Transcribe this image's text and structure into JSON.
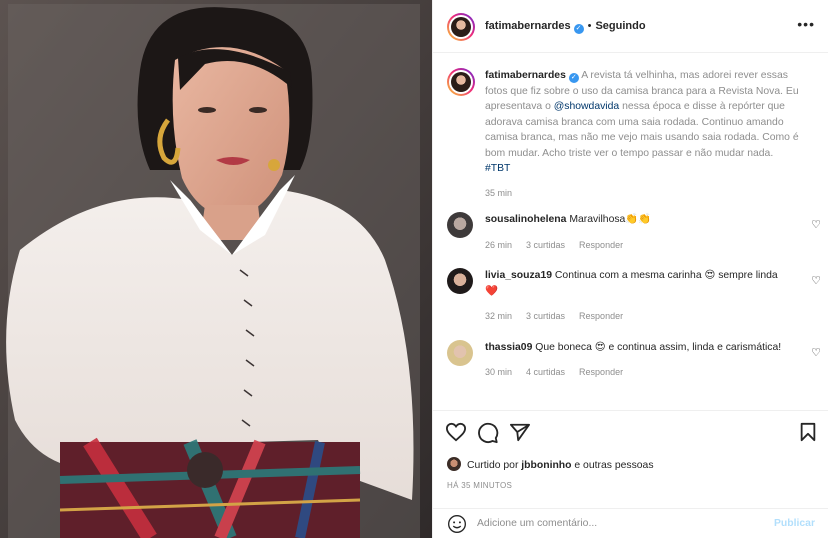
{
  "post": {
    "username": "fatimabernardes",
    "following_label": "Seguindo",
    "separator": "•",
    "more_icon": "more-icon"
  },
  "caption": {
    "username": "fatimabernardes",
    "text_1": "A revista tá velhinha, mas adorei rever essas fotos que fiz sobre o uso da camisa branca para a Revista Nova. Eu apresentava o ",
    "mention": "@showdavida",
    "text_2": " nessa época e disse à repórter que adorava camisa branca com uma saia rodada. Continuo amando camisa branca, mas não me vejo mais usando saia rodada. Como é bom mudar. Acho triste ver o tempo passar e não mudar nada.",
    "hashtag": "#TBT",
    "time": "35 min"
  },
  "comments": [
    {
      "user": "sousalinohelena",
      "text": "Maravilhosa👏👏",
      "time": "26 min",
      "likes": "3 curtidas",
      "reply": "Responder"
    },
    {
      "user": "livia_souza19",
      "text": "Continua com a mesma carinha 😍 sempre linda ❤️",
      "time": "32 min",
      "likes": "3 curtidas",
      "reply": "Responder"
    },
    {
      "user": "thassia09",
      "text": "Que boneca 😍 e continua assim, linda e carismática!",
      "time": "30 min",
      "likes": "4 curtidas",
      "reply": "Responder"
    }
  ],
  "likes": {
    "prefix": "Curtido por ",
    "user": "jbboninho",
    "suffix": " e outras pessoas"
  },
  "posted_ago": "HÁ 35 MINUTOS",
  "add_comment": {
    "placeholder": "Adicione um comentário...",
    "publish": "Publicar"
  },
  "colors": {
    "link": "#00376b",
    "verified": "#3897f0",
    "publish_disabled": "#b2dffc",
    "muted": "#8e8e8e"
  }
}
